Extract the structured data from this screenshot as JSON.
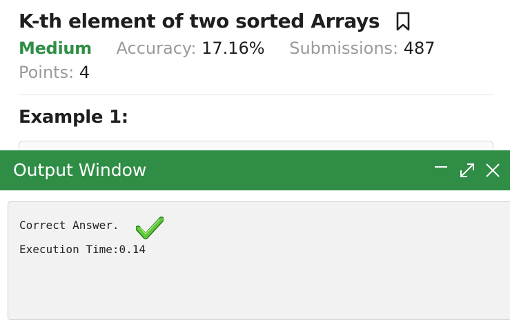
{
  "problem": {
    "title": "K-th element of two sorted Arrays",
    "difficulty": "Medium",
    "accuracy_label": "Accuracy:",
    "accuracy_value": "17.16%",
    "submissions_label": "Submissions:",
    "submissions_value": "487",
    "points_label": "Points:",
    "points_value": "4",
    "example_heading": "Example 1:",
    "bookmark_icon": "bookmark-icon"
  },
  "output_window": {
    "title": "Output Window",
    "controls": [
      "minimize-icon",
      "expand-icon",
      "close-icon"
    ],
    "result_text": "Correct Answer.",
    "result_icon": "checkmark-icon",
    "execution_text": "Execution Time:0.14"
  },
  "colors": {
    "accent_green": "#2f8d46",
    "muted_text": "#9a9a9a",
    "output_bg": "#f2f2f2"
  }
}
